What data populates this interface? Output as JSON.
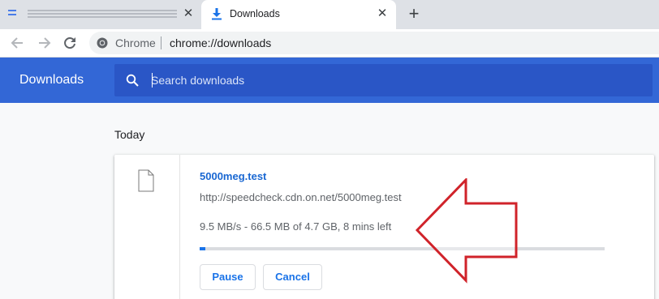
{
  "tabs": {
    "inactive": {
      "close_glyph": "✕"
    },
    "active": {
      "title": "Downloads",
      "close_glyph": "✕"
    },
    "new_tab_glyph": "+"
  },
  "toolbar": {
    "omnibox": {
      "site_name": "Chrome",
      "url": "chrome://downloads"
    }
  },
  "downloads_page": {
    "heading": "Downloads",
    "search": {
      "placeholder": "Search downloads",
      "value": ""
    },
    "section_label": "Today",
    "item": {
      "file_name": "5000meg.test",
      "url": "http://speedcheck.cdn.on.net/5000meg.test",
      "progress_text": "9.5 MB/s - 66.5 MB of 4.7 GB, 8 mins left",
      "progress_fraction": 0.014,
      "pause_label": "Pause",
      "cancel_label": "Cancel"
    }
  },
  "colors": {
    "header_blue": "#3367d6",
    "search_blue": "#2a56c6",
    "link_blue": "#1967d2",
    "progress_blue": "#1a73e8",
    "annotation_red": "#d0232a"
  },
  "icons": [
    "tab-favicon-icon",
    "download-icon",
    "close-icon",
    "plus-icon",
    "back-arrow-icon",
    "forward-arrow-icon",
    "reload-icon",
    "chrome-logo-icon",
    "search-icon",
    "file-icon",
    "red-arrow-annotation"
  ]
}
